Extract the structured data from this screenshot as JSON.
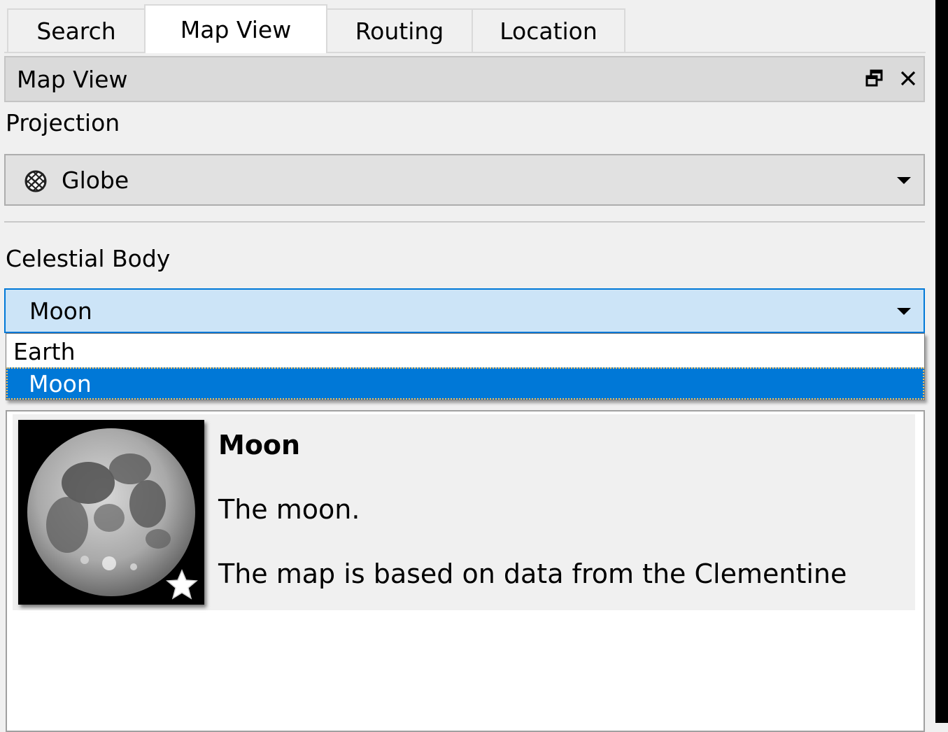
{
  "tabs": [
    {
      "label": "Search",
      "active": false
    },
    {
      "label": "Map View",
      "active": true
    },
    {
      "label": "Routing",
      "active": false
    },
    {
      "label": "Location",
      "active": false
    }
  ],
  "dock": {
    "title": "Map View",
    "float_icon": "float-window-icon",
    "close_icon": "close-icon"
  },
  "projection": {
    "label": "Projection",
    "selected": "Globe",
    "icon": "globe-icon"
  },
  "celestial_body": {
    "label": "Celestial Body",
    "selected": "Moon",
    "options": [
      "Earth",
      "Moon"
    ]
  },
  "info": {
    "title": "Moon",
    "description": "The moon.",
    "details": "The map is based on data from the Clementine",
    "thumbnail_icon": "moon-image",
    "badge_icon": "star-icon"
  },
  "colors": {
    "accent": "#0078d7",
    "focus_bg": "#cce4f7"
  }
}
